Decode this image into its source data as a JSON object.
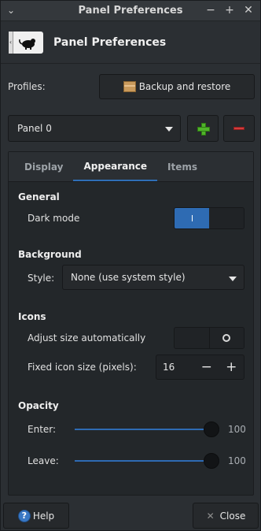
{
  "window": {
    "title": "Panel Preferences",
    "menu_glyph": "⌄",
    "minimize_glyph": "−",
    "maximize_glyph": "+",
    "close_glyph": "✕"
  },
  "header": {
    "title": "Panel Preferences",
    "icon": "panel-mouse-icon"
  },
  "profiles": {
    "label": "Profiles:",
    "backup_button": "Backup and restore"
  },
  "panel_selector": {
    "selected": "Panel 0"
  },
  "tabs": [
    {
      "label": "Display",
      "active": false
    },
    {
      "label": "Appearance",
      "active": true
    },
    {
      "label": "Items",
      "active": false
    }
  ],
  "appearance": {
    "general": {
      "title": "General",
      "dark_mode_label": "Dark mode",
      "dark_mode_on": true
    },
    "background": {
      "title": "Background",
      "style_label": "Style:",
      "style_value": "None (use system style)"
    },
    "icons": {
      "title": "Icons",
      "adjust_label": "Adjust size automatically",
      "adjust_on": false,
      "fixed_label": "Fixed icon size (pixels):",
      "fixed_value": "16",
      "minus": "−",
      "plus": "+"
    },
    "opacity": {
      "title": "Opacity",
      "enter_label": "Enter:",
      "enter_value": "100",
      "leave_label": "Leave:",
      "leave_value": "100"
    }
  },
  "footer": {
    "help": "Help",
    "close": "Close"
  },
  "colors": {
    "accent": "#2e6bb3",
    "add": "#4fb32a",
    "remove": "#d23c3c"
  }
}
